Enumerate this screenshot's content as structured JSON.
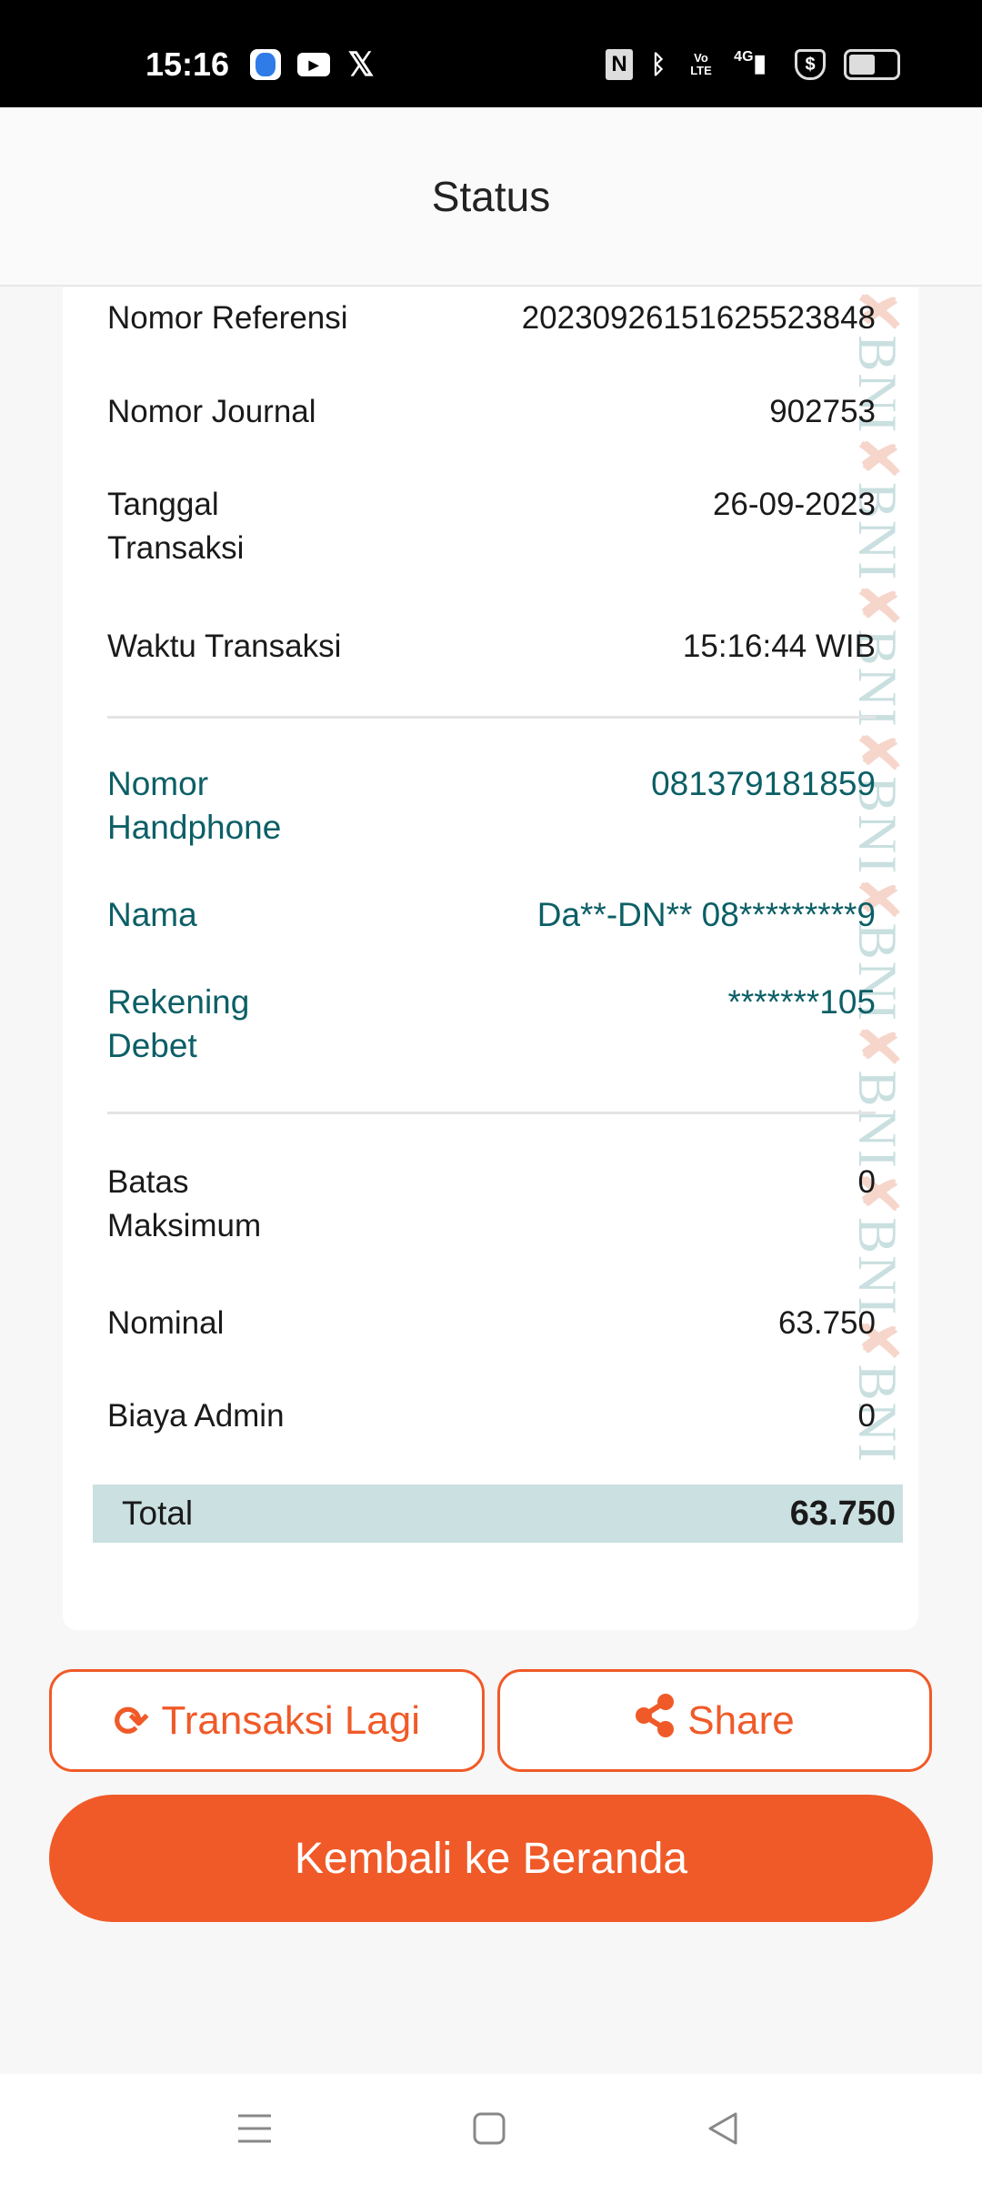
{
  "status_bar": {
    "time": "15:16",
    "network": "4G",
    "volte": "Vo LTE"
  },
  "header": {
    "title": "Status"
  },
  "details": [
    {
      "label": "Nomor Referensi",
      "value": "20230926151625523848"
    },
    {
      "label": "Nomor Journal",
      "value": "902753"
    },
    {
      "label": "Tanggal Transaksi",
      "value": "26-09-2023"
    },
    {
      "label": "Waktu Transaksi",
      "value": "15:16:44 WIB"
    }
  ],
  "account": [
    {
      "label": "Nomor Handphone",
      "value": "081379181859"
    },
    {
      "label": "Nama",
      "value": "Da**-DN** 08*********9"
    },
    {
      "label": "Rekening Debet",
      "value": "*******105"
    }
  ],
  "amounts": [
    {
      "label": "Batas Maksimum",
      "value": "0"
    },
    {
      "label": "Nominal",
      "value": "63.750"
    },
    {
      "label": "Biaya Admin",
      "value": "0"
    }
  ],
  "total": {
    "label": "Total",
    "value": "63.750"
  },
  "watermark": "BNI",
  "buttons": {
    "again": "Transaksi Lagi",
    "share": "Share",
    "home": "Kembali ke Beranda"
  },
  "colors": {
    "accent": "#f05a28",
    "teal": "#0c5f66",
    "total_bg": "#cbe0e1"
  }
}
